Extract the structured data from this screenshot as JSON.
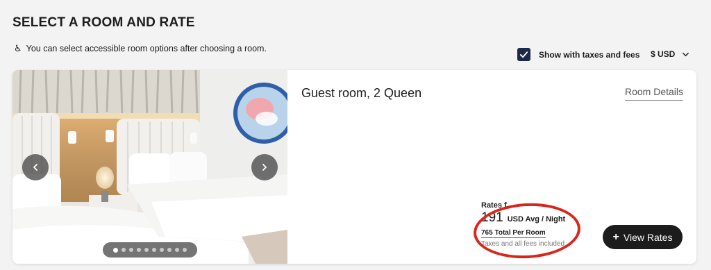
{
  "page": {
    "title": "SELECT A ROOM AND RATE",
    "accessible_note": "You can select accessible room options after choosing a room.",
    "accessible_icon": "wheelchair-icon"
  },
  "filters": {
    "tax_label": "Show with taxes and fees",
    "tax_checked": true,
    "currency": "$ USD"
  },
  "room": {
    "name": "Guest room, 2 Queen",
    "details_link": "Room Details",
    "carousel": {
      "total_images": 10,
      "active_index": 0
    },
    "rates": {
      "label": "Rates f",
      "price": "191",
      "price_unit": "USD Avg / Night",
      "total": "765 Total Per Room",
      "fees_note": "Taxes and all fees included"
    },
    "view_rates_label": "View Rates",
    "view_rates_icon": "plus-icon"
  },
  "colors": {
    "checkbox": "#1c2a47",
    "button": "#1c1c1c",
    "annotation": "#d9261c"
  }
}
